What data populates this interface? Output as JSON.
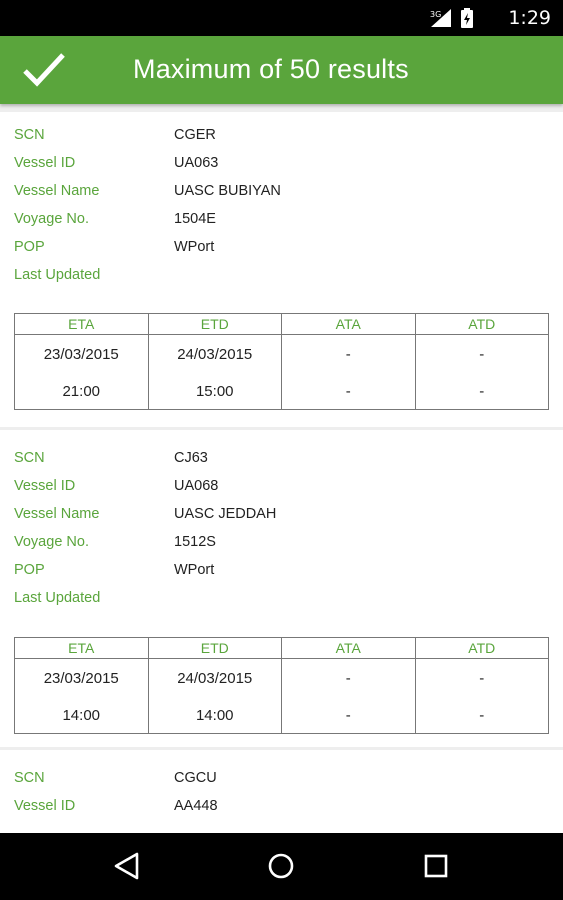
{
  "status_bar": {
    "network": "3G",
    "time": "1:29"
  },
  "app_bar": {
    "title": "Maximum of 50 results"
  },
  "labels": {
    "scn": "SCN",
    "vessel_id": "Vessel ID",
    "vessel_name": "Vessel Name",
    "voyage_no": "Voyage No.",
    "pop": "POP",
    "last_updated": "Last Updated"
  },
  "time_headers": {
    "eta": "ETA",
    "etd": "ETD",
    "ata": "ATA",
    "atd": "ATD"
  },
  "results": [
    {
      "scn": "CGER",
      "vessel_id": "UA063",
      "vessel_name": "UASC BUBIYAN",
      "voyage_no": "1504E",
      "pop": "WPort",
      "last_updated": "",
      "eta_date": "23/03/2015",
      "eta_time": "21:00",
      "etd_date": "24/03/2015",
      "etd_time": "15:00",
      "ata_date": "-",
      "ata_time": "-",
      "atd_date": "-",
      "atd_time": "-"
    },
    {
      "scn": "CJ63",
      "vessel_id": "UA068",
      "vessel_name": "UASC JEDDAH",
      "voyage_no": "1512S",
      "pop": "WPort",
      "last_updated": "",
      "eta_date": "23/03/2015",
      "eta_time": "14:00",
      "etd_date": "24/03/2015",
      "etd_time": "14:00",
      "ata_date": "-",
      "ata_time": "-",
      "atd_date": "-",
      "atd_time": "-"
    },
    {
      "scn": "CGCU",
      "vessel_id": "AA448"
    }
  ],
  "icons": {
    "confirm": "check-icon",
    "back": "back-triangle-icon",
    "home": "home-circle-icon",
    "recents": "recents-square-icon",
    "signal": "signal-icon",
    "battery": "battery-icon"
  }
}
